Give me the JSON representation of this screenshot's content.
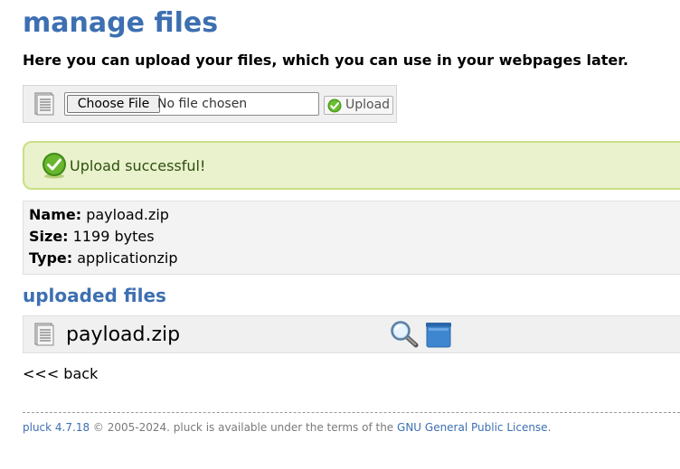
{
  "header": {
    "title": "manage files",
    "subtitle": "Here you can upload your files, which you can use in your webpages later."
  },
  "upload": {
    "choose_label": "Choose File",
    "file_status": "No file chosen",
    "upload_label": "Upload"
  },
  "status": {
    "message": "Upload successful!"
  },
  "file_info": {
    "name_label": "Name:",
    "name_value": "payload.zip",
    "size_label": "Size:",
    "size_value": "1199 bytes",
    "type_label": "Type:",
    "type_value": "applicationzip"
  },
  "uploaded": {
    "heading": "uploaded files",
    "files": [
      {
        "name": "payload.zip"
      }
    ]
  },
  "nav": {
    "back_label": "<<< back"
  },
  "footer": {
    "version_link": "pluck 4.7.18",
    "text": "© 2005-2024. pluck is available under the terms of the",
    "license_link": "GNU General Public License",
    "end": "."
  },
  "icons": {
    "document": "document-icon",
    "check": "check-icon",
    "magnifier": "magnifier-icon",
    "trash": "trash-icon"
  },
  "colors": {
    "heading": "#3d6fb1",
    "success_bg": "#e9f2cc",
    "success_border": "#c9df85",
    "check_green": "#4c9a1e"
  }
}
